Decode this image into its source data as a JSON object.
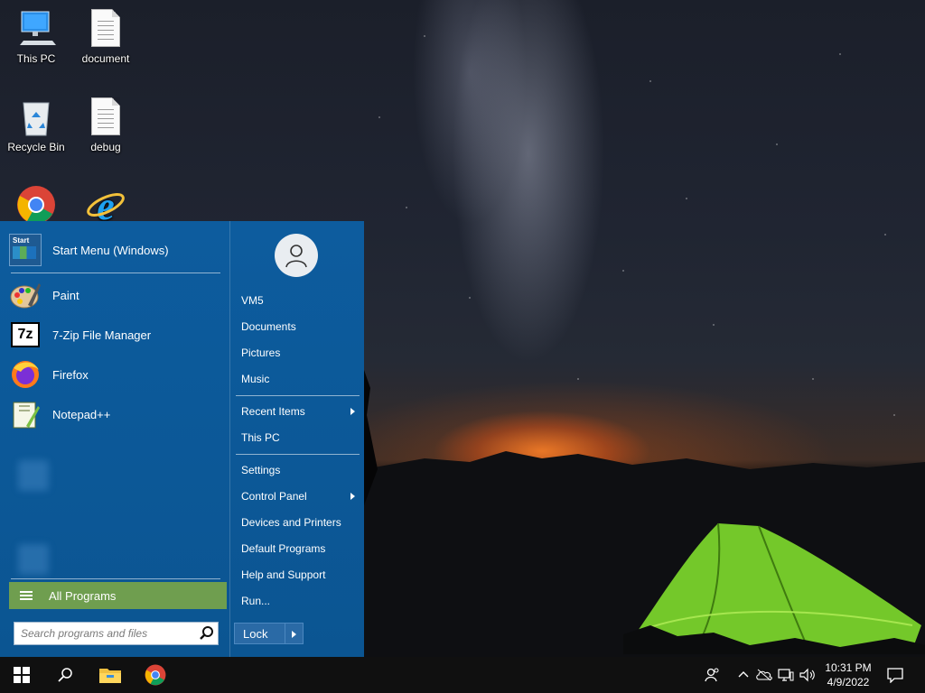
{
  "desktop": {
    "icons": [
      {
        "label": "This PC",
        "icon": "this-pc-icon"
      },
      {
        "label": "document",
        "icon": "text-file-icon"
      },
      {
        "label": "Recycle Bin",
        "icon": "recycle-bin-icon"
      },
      {
        "label": "debug",
        "icon": "text-file-icon"
      },
      {
        "label": "",
        "icon": "chrome-icon"
      },
      {
        "label": "",
        "icon": "internet-explorer-icon"
      }
    ]
  },
  "start_menu": {
    "header": {
      "label": "Start Menu (Windows)",
      "icon_text": "Start"
    },
    "pinned": [
      {
        "label": "Paint",
        "icon": "paint-icon"
      },
      {
        "label": "7-Zip File Manager",
        "icon": "7zip-icon",
        "icon_text": "7z"
      },
      {
        "label": "Firefox",
        "icon": "firefox-icon"
      },
      {
        "label": "Notepad++",
        "icon": "notepad-plus-plus-icon"
      }
    ],
    "all_programs": "All Programs",
    "search_placeholder": "Search programs and files",
    "right": {
      "user": "VM5",
      "items": [
        {
          "label": "Documents"
        },
        {
          "label": "Pictures"
        },
        {
          "label": "Music"
        },
        {
          "label": "Recent Items",
          "submenu": true
        },
        {
          "label": "This PC"
        },
        {
          "label": "Settings"
        },
        {
          "label": "Control Panel",
          "submenu": true
        },
        {
          "label": "Devices and Printers"
        },
        {
          "label": "Default Programs"
        },
        {
          "label": "Help and Support"
        },
        {
          "label": "Run..."
        }
      ],
      "lock": "Lock"
    }
  },
  "taskbar": {
    "buttons": [
      "windows-start-icon",
      "search-icon",
      "file-explorer-icon",
      "chrome-icon"
    ],
    "tray": [
      "people-icon",
      "chevron-up-icon",
      "onedrive-icon",
      "network-icon",
      "volume-icon"
    ],
    "time": "10:31 PM",
    "date": "4/9/2022",
    "notification": "action-center-icon"
  },
  "colors": {
    "start_menu_bg": "#0d5c9e",
    "all_programs_bg": "#6f9e4f",
    "taskbar_bg": "#101010"
  }
}
